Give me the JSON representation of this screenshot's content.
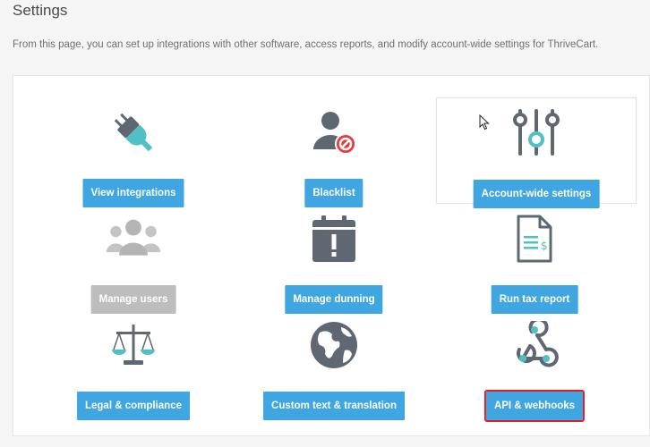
{
  "header": {
    "title": "Settings",
    "description": "From this page, you can set up integrations with other software, access reports, and modify account-wide settings for ThriveCart."
  },
  "colors": {
    "primary_button": "#3fa6e1",
    "disabled_button": "#bdbdbd",
    "highlight_outline": "#e21d24",
    "teal_accent": "#4fc1c4",
    "icon_gray": "#5f6872"
  },
  "tiles": [
    {
      "label": "View integrations",
      "icon": "plug-icon"
    },
    {
      "label": "Blacklist",
      "icon": "user-blocked-icon"
    },
    {
      "label": "Account-wide settings",
      "icon": "sliders-icon"
    },
    {
      "label": "Manage users",
      "icon": "users-icon",
      "state": "disabled"
    },
    {
      "label": "Manage dunning",
      "icon": "calendar-alert-icon"
    },
    {
      "label": "Run tax report",
      "icon": "tax-document-icon"
    },
    {
      "label": "Legal & compliance",
      "icon": "scales-icon"
    },
    {
      "label": "Custom text & translation",
      "icon": "globe-icon"
    },
    {
      "label": "API & webhooks",
      "icon": "webhook-icon",
      "state": "highlighted"
    }
  ]
}
